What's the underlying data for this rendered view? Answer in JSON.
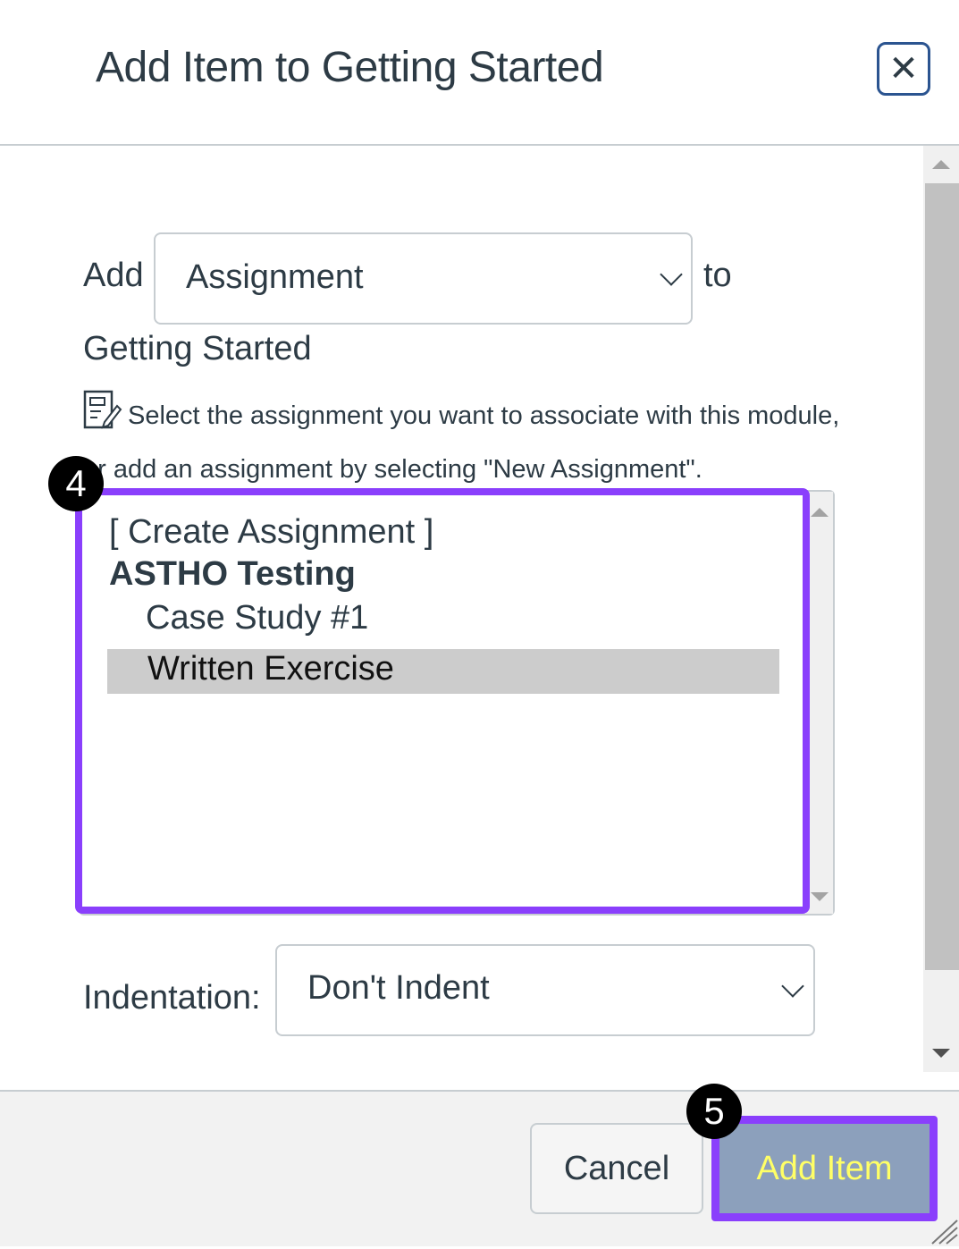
{
  "dialog": {
    "title": "Add Item to Getting Started",
    "close_label": "✕"
  },
  "form": {
    "add_label": "Add",
    "item_type": {
      "selected": "Assignment"
    },
    "to_label": "to",
    "module_name": "Getting Started",
    "help_text": "Select the assignment you want to associate with this module, or add an assignment by selecting \"New Assignment\".",
    "assignment_list": {
      "options": [
        {
          "label": "[ Create Assignment ]",
          "kind": "option"
        },
        {
          "label": "ASTHO Testing",
          "kind": "group"
        },
        {
          "label": "Case Study #1",
          "kind": "option"
        },
        {
          "label": "Written Exercise",
          "kind": "option",
          "selected": true
        }
      ]
    },
    "indentation_label": "Indentation:",
    "indentation": {
      "selected": "Don't Indent"
    }
  },
  "annotations": {
    "step_4": "4",
    "step_5": "5",
    "highlight_color": "#8a3ffc"
  },
  "footer": {
    "cancel_label": "Cancel",
    "add_item_label": "Add Item"
  }
}
